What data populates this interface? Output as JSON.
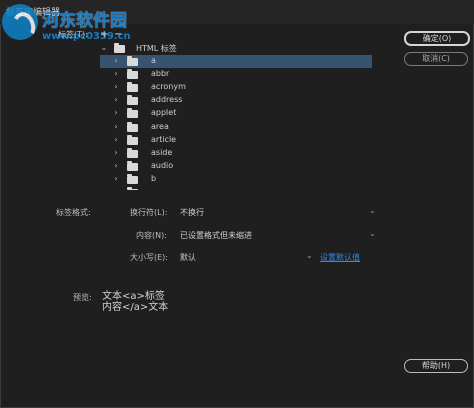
{
  "window": {
    "title": "标签库编辑器"
  },
  "watermark": {
    "brand": "河东软件园",
    "url": "www.pc0359.cn"
  },
  "tags_label": "标签(T):",
  "toolbar": {
    "add": "+",
    "remove": "−"
  },
  "tree": {
    "root": {
      "label": "HTML 标签",
      "expanded": true
    },
    "items": [
      {
        "label": "a",
        "selected": true
      },
      {
        "label": "abbr",
        "selected": false
      },
      {
        "label": "acronym",
        "selected": false
      },
      {
        "label": "address",
        "selected": false
      },
      {
        "label": "applet",
        "selected": false
      },
      {
        "label": "area",
        "selected": false
      },
      {
        "label": "article",
        "selected": false
      },
      {
        "label": "aside",
        "selected": false
      },
      {
        "label": "audio",
        "selected": false
      },
      {
        "label": "b",
        "selected": false
      },
      {
        "label": "",
        "selected": false
      }
    ]
  },
  "buttons": {
    "ok": "确定(O)",
    "cancel": "取消(C)",
    "help": "帮助(H)"
  },
  "format": {
    "section_label": "标签格式:",
    "line_breaks": {
      "label": "换行符(L):",
      "value": "不换行"
    },
    "contents": {
      "label": "内容(N):",
      "value": "已设置格式但未缩进"
    },
    "case": {
      "label": "大小写(E):",
      "value": "默认",
      "link": "设置默认值"
    }
  },
  "preview": {
    "label": "预览:",
    "text": "文本<a>标签\n内容</a>文本"
  },
  "colors": {
    "background": "#1f1f1f",
    "selection": "#36536f",
    "link": "#2d8ceb"
  }
}
